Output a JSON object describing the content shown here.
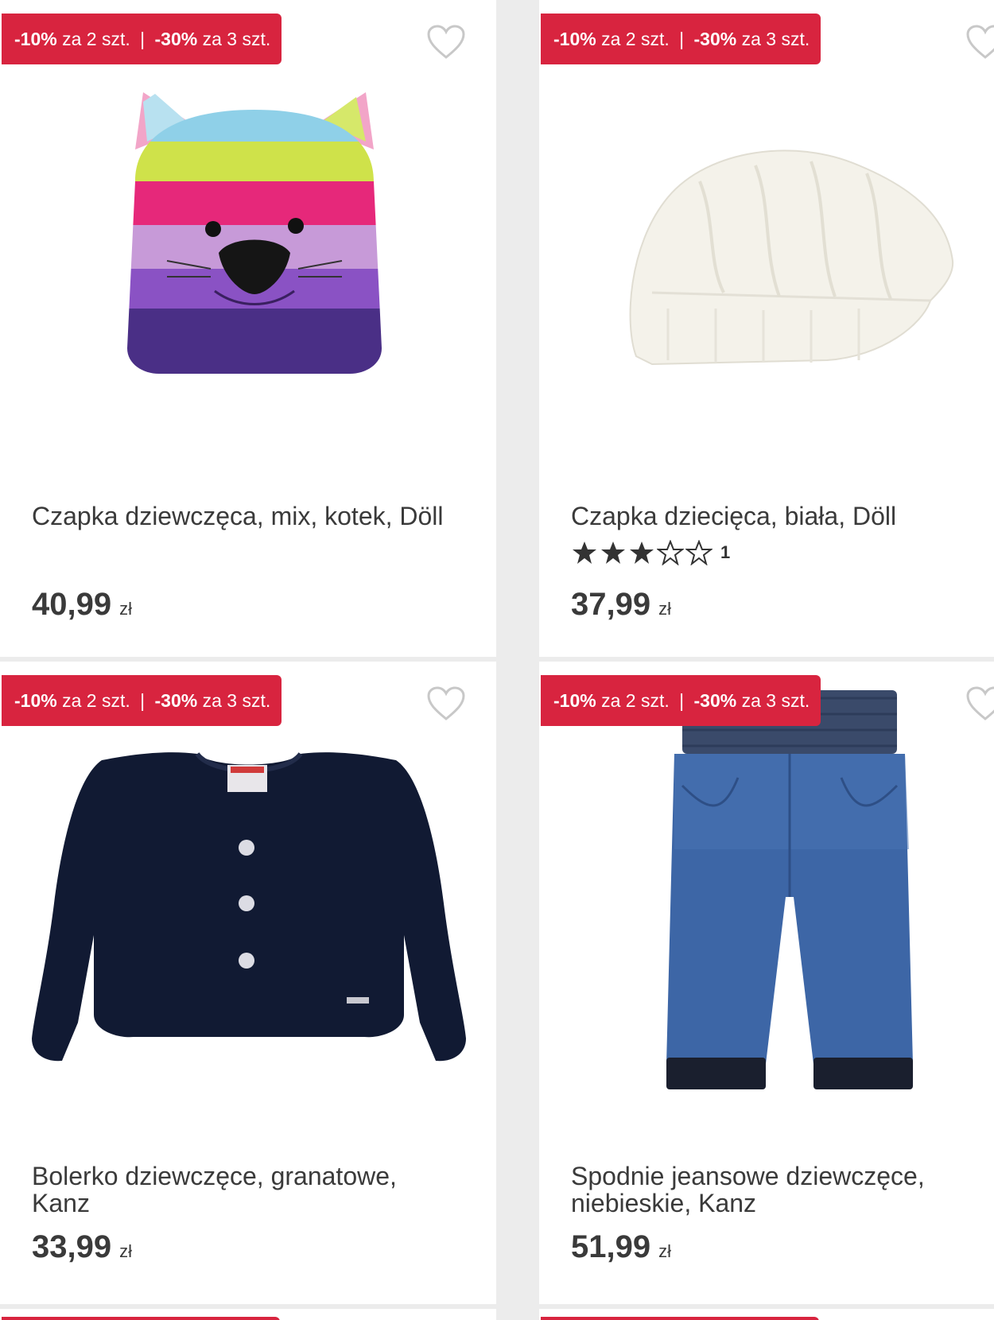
{
  "colors": {
    "promo_red": "#d8243f",
    "text_dark": "#3a3a3a",
    "background": "#ececec"
  },
  "products": [
    {
      "promo": {
        "first_pct": "-10%",
        "first_rest": "za 2 szt.",
        "separator": "|",
        "second_pct": "-30%",
        "second_rest": "za 3 szt."
      },
      "title": "Czapka dziewczęca, mix, kotek, Döll",
      "price": "40,99",
      "currency": "zł",
      "image_icon": "knitted-cat-hat-icon"
    },
    {
      "promo": {
        "first_pct": "-10%",
        "first_rest": "za 2 szt.",
        "separator": "|",
        "second_pct": "-30%",
        "second_rest": "za 3 szt."
      },
      "title": "Czapka dziecięca, biała, Döll",
      "rating": {
        "stars": 3,
        "max": 5,
        "count": "1"
      },
      "price": "37,99",
      "currency": "zł",
      "image_icon": "white-beanie-icon"
    },
    {
      "promo": {
        "first_pct": "-10%",
        "first_rest": "za 2 szt.",
        "separator": "|",
        "second_pct": "-30%",
        "second_rest": "za 3 szt."
      },
      "title": "Bolerko dziewczęce, granatowe, Kanz",
      "price": "33,99",
      "currency": "zł",
      "image_icon": "navy-cardigan-icon"
    },
    {
      "promo": {
        "first_pct": "-10%",
        "first_rest": "za 2 szt.",
        "separator": "|",
        "second_pct": "-30%",
        "second_rest": "za 3 szt."
      },
      "title": "Spodnie jeansowe dziewczęce, niebieskie, Kanz",
      "price": "51,99",
      "currency": "zł",
      "image_icon": "denim-pants-icon"
    }
  ]
}
